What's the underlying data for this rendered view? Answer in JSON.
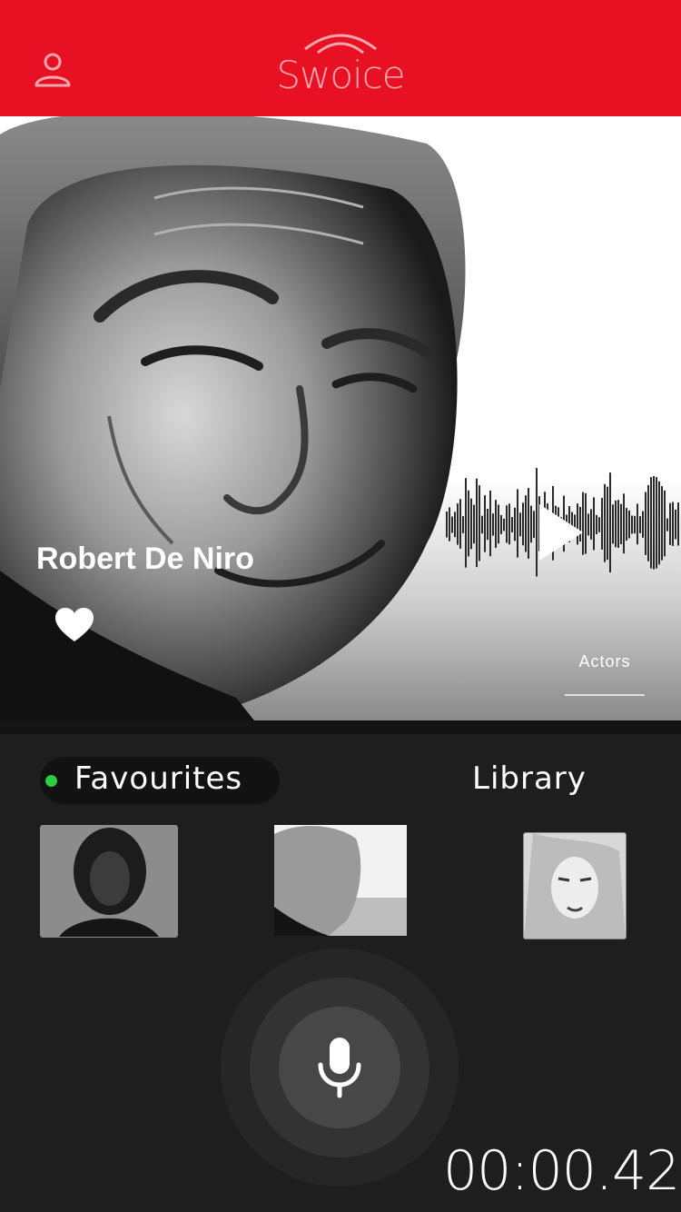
{
  "header": {
    "app_name": "Swoice",
    "user_icon": "user-icon",
    "brand_color": "#e81123"
  },
  "hero": {
    "name": "Robert De Niro",
    "favorite_icon": "heart-icon",
    "play_icon": "play-icon",
    "category": "Actors"
  },
  "tabs": {
    "favourites_label": "Favourites",
    "library_label": "Library",
    "active_dot_color": "#2ecc40"
  },
  "recorder": {
    "mic_icon": "microphone-icon",
    "timer": "00:00.42"
  }
}
